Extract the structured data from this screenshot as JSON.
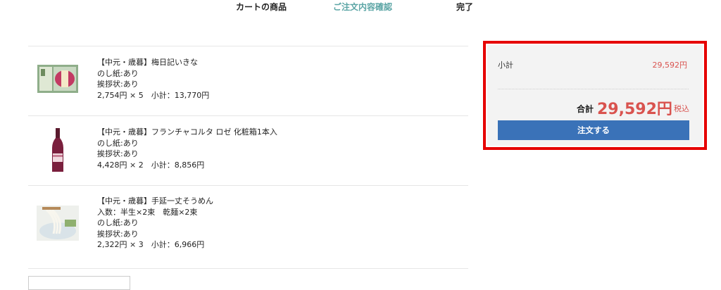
{
  "steps": {
    "cart": "カートの商品",
    "confirm": "ご注文内容確認",
    "complete": "完了"
  },
  "items": [
    {
      "name": "【中元・歳暮】梅日記いきな",
      "lines": [
        "のし紙:あり",
        "挨拶状:あり"
      ],
      "price": "2,754円 × 5",
      "subtotal": "小計：13,770円",
      "image": "umeboshi-box"
    },
    {
      "name": "【中元・歳暮】フランチャコルタ ロゼ 化粧箱1本入",
      "lines": [
        "のし紙:あり",
        "挨拶状:あり"
      ],
      "price": "4,428円 × 2",
      "subtotal": "小計：8,856円",
      "image": "wine-bottle"
    },
    {
      "name": "【中元・歳暮】手延一丈そうめん",
      "lines": [
        "入数：半生×2束　乾麺×2束",
        "のし紙:あり",
        "挨拶状:あり"
      ],
      "price": "2,322円 × 3",
      "subtotal": "小計：6,966円",
      "image": "somen-noodles"
    }
  ],
  "summary": {
    "subtotal_label": "小計",
    "subtotal_value": "29,592円",
    "total_label": "合計",
    "total_value": "29,592円",
    "tax_label": "税込",
    "order_button": "注文する"
  },
  "colors": {
    "active_step": "#5ba5a5",
    "price_red": "#d9534f",
    "button_blue": "#3a72b8",
    "highlight_border": "#e60000"
  }
}
